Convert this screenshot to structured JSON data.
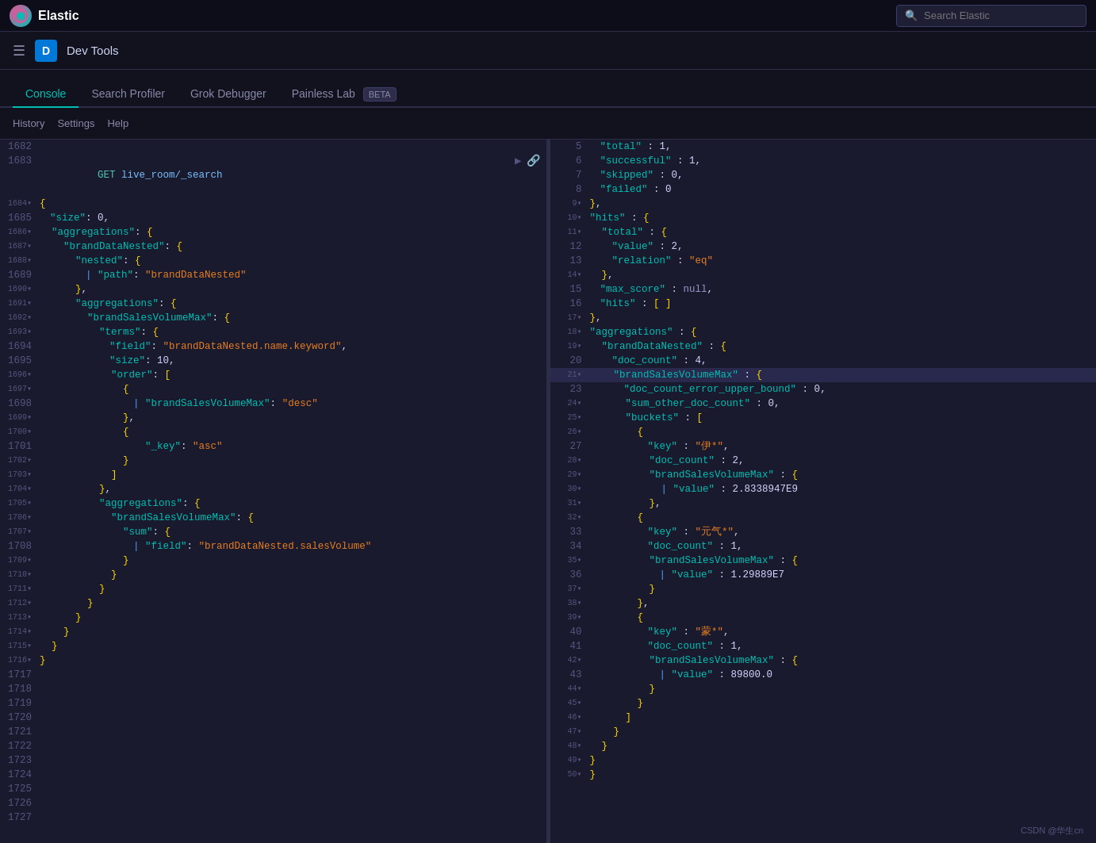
{
  "navbar": {
    "logo_text": "Elastic",
    "search_placeholder": "Search Elastic"
  },
  "breadcrumb": {
    "badge_letter": "D",
    "title": "Dev Tools"
  },
  "tabs": [
    {
      "label": "Console",
      "active": true
    },
    {
      "label": "Search Profiler",
      "active": false
    },
    {
      "label": "Grok Debugger",
      "active": false
    },
    {
      "label": "Painless Lab",
      "active": false,
      "beta": true
    }
  ],
  "toolbar": {
    "history": "History",
    "settings": "Settings",
    "help": "Help"
  },
  "editor": {
    "lines": [
      {
        "num": "1682",
        "fold": false,
        "content": ""
      },
      {
        "num": "1683",
        "fold": false,
        "content": "GET live_room/_search",
        "is_request": true
      },
      {
        "num": "1684",
        "fold": true,
        "content": "{"
      },
      {
        "num": "1685",
        "fold": false,
        "content": "  \"size\": 0,"
      },
      {
        "num": "1686",
        "fold": true,
        "content": "  \"aggregations\": {"
      },
      {
        "num": "1687",
        "fold": true,
        "content": "    \"brandDataNested\": {"
      },
      {
        "num": "1688",
        "fold": true,
        "content": "      \"nested\": {"
      },
      {
        "num": "1689",
        "fold": false,
        "content": "        | \"path\": \"brandDataNested\""
      },
      {
        "num": "1690",
        "fold": true,
        "content": "      },"
      },
      {
        "num": "1691",
        "fold": true,
        "content": "      \"aggregations\": {"
      },
      {
        "num": "1692",
        "fold": true,
        "content": "        \"brandSalesVolumeMax\": {"
      },
      {
        "num": "1693",
        "fold": true,
        "content": "          \"terms\": {"
      },
      {
        "num": "1694",
        "fold": false,
        "content": "            \"field\": \"brandDataNested.name.keyword\","
      },
      {
        "num": "1695",
        "fold": false,
        "content": "            \"size\": 10,"
      },
      {
        "num": "1696",
        "fold": true,
        "content": "            \"order\": ["
      },
      {
        "num": "1697",
        "fold": true,
        "content": "              {"
      },
      {
        "num": "1698",
        "fold": false,
        "content": "                | \"brandSalesVolumeMax\": \"desc\""
      },
      {
        "num": "1699",
        "fold": true,
        "content": "              },"
      },
      {
        "num": "1700",
        "fold": true,
        "content": "              {"
      },
      {
        "num": "1701",
        "fold": false,
        "content": "                  \"_key\": \"asc\""
      },
      {
        "num": "1702",
        "fold": true,
        "content": "              }"
      },
      {
        "num": "1703",
        "fold": true,
        "content": "            ]"
      },
      {
        "num": "1704",
        "fold": true,
        "content": "          },"
      },
      {
        "num": "1705",
        "fold": true,
        "content": "          \"aggregations\": {"
      },
      {
        "num": "1706",
        "fold": true,
        "content": "            \"brandSalesVolumeMax\": {"
      },
      {
        "num": "1707",
        "fold": true,
        "content": "              \"sum\": {"
      },
      {
        "num": "1708",
        "fold": false,
        "content": "                | \"field\": \"brandDataNested.salesVolume\""
      },
      {
        "num": "1709",
        "fold": true,
        "content": "              }"
      },
      {
        "num": "1710",
        "fold": true,
        "content": "            }"
      },
      {
        "num": "1711",
        "fold": true,
        "content": "          }"
      },
      {
        "num": "1712",
        "fold": true,
        "content": "        }"
      },
      {
        "num": "1713",
        "fold": true,
        "content": "      }"
      },
      {
        "num": "1714",
        "fold": true,
        "content": "    }"
      },
      {
        "num": "1715",
        "fold": true,
        "content": "  }"
      },
      {
        "num": "1716",
        "fold": true,
        "content": "}"
      },
      {
        "num": "1717",
        "fold": false,
        "content": ""
      },
      {
        "num": "1718",
        "fold": false,
        "content": ""
      },
      {
        "num": "1719",
        "fold": false,
        "content": ""
      },
      {
        "num": "1720",
        "fold": false,
        "content": ""
      },
      {
        "num": "1721",
        "fold": false,
        "content": ""
      },
      {
        "num": "1722",
        "fold": false,
        "content": ""
      },
      {
        "num": "1723",
        "fold": false,
        "content": ""
      },
      {
        "num": "1724",
        "fold": false,
        "content": ""
      },
      {
        "num": "1725",
        "fold": false,
        "content": ""
      },
      {
        "num": "1726",
        "fold": false,
        "content": ""
      },
      {
        "num": "1727",
        "fold": false,
        "content": ""
      }
    ]
  },
  "response": {
    "lines": [
      {
        "num": "5",
        "fold": false,
        "content": "  \"total\" : 1,"
      },
      {
        "num": "6",
        "fold": false,
        "content": "  \"successful\" : 1,"
      },
      {
        "num": "7",
        "fold": false,
        "content": "  \"skipped\" : 0,"
      },
      {
        "num": "8",
        "fold": false,
        "content": "  \"failed\" : 0"
      },
      {
        "num": "9",
        "fold": true,
        "content": "},"
      },
      {
        "num": "10",
        "fold": true,
        "content": "\"hits\" : {"
      },
      {
        "num": "11",
        "fold": true,
        "content": "  \"total\" : {"
      },
      {
        "num": "12",
        "fold": false,
        "content": "    \"value\" : 2,"
      },
      {
        "num": "13",
        "fold": false,
        "content": "    \"relation\" : \"eq\""
      },
      {
        "num": "14",
        "fold": true,
        "content": "  },"
      },
      {
        "num": "15",
        "fold": false,
        "content": "  \"max_score\" : null,"
      },
      {
        "num": "16",
        "fold": false,
        "content": "  \"hits\" : [ ]"
      },
      {
        "num": "17",
        "fold": true,
        "content": "},"
      },
      {
        "num": "18",
        "fold": true,
        "content": "\"aggregations\" : {"
      },
      {
        "num": "19",
        "fold": true,
        "content": "  \"brandDataNested\" : {"
      },
      {
        "num": "20",
        "fold": false,
        "content": "    \"doc_count\" : 4,"
      },
      {
        "num": "21",
        "fold": true,
        "content": "    \"brandSalesVolumeMax\" : {",
        "highlighted": true
      },
      {
        "num": "23",
        "fold": false,
        "content": "      \"doc_count_error_upper_bound\" : 0,"
      },
      {
        "num": "24",
        "fold": false,
        "content": "      \"sum_other_doc_count\" : 0,"
      },
      {
        "num": "25",
        "fold": true,
        "content": "      \"buckets\" : ["
      },
      {
        "num": "26",
        "fold": true,
        "content": "        {"
      },
      {
        "num": "27",
        "fold": false,
        "content": "          \"key\" : \"伊*\","
      },
      {
        "num": "28",
        "fold": true,
        "content": "          \"doc_count\" : 2,"
      },
      {
        "num": "29",
        "fold": true,
        "content": "          \"brandSalesVolumeMax\" : {"
      },
      {
        "num": "30",
        "fold": true,
        "content": "            | \"value\" : 2.8338947E9"
      },
      {
        "num": "31",
        "fold": true,
        "content": "          },"
      },
      {
        "num": "32",
        "fold": true,
        "content": "        {"
      },
      {
        "num": "33",
        "fold": false,
        "content": "          \"key\" : \"元气*\","
      },
      {
        "num": "34",
        "fold": false,
        "content": "          \"doc_count\" : 1,"
      },
      {
        "num": "35",
        "fold": true,
        "content": "          \"brandSalesVolumeMax\" : {"
      },
      {
        "num": "36",
        "fold": false,
        "content": "            | \"value\" : 1.29889E7"
      },
      {
        "num": "37",
        "fold": true,
        "content": "          }"
      },
      {
        "num": "38",
        "fold": true,
        "content": "        },"
      },
      {
        "num": "39",
        "fold": true,
        "content": "        {"
      },
      {
        "num": "40",
        "fold": false,
        "content": "          \"key\" : \"蒙*\","
      },
      {
        "num": "41",
        "fold": false,
        "content": "          \"doc_count\" : 1,"
      },
      {
        "num": "42",
        "fold": true,
        "content": "          \"brandSalesVolumeMax\" : {"
      },
      {
        "num": "43",
        "fold": false,
        "content": "            | \"value\" : 89800.0"
      },
      {
        "num": "44",
        "fold": true,
        "content": "          }"
      },
      {
        "num": "45",
        "fold": true,
        "content": "        }"
      },
      {
        "num": "46",
        "fold": true,
        "content": "      ]"
      },
      {
        "num": "47",
        "fold": true,
        "content": "    }"
      },
      {
        "num": "48",
        "fold": true,
        "content": "  }"
      },
      {
        "num": "49",
        "fold": true,
        "content": "}"
      },
      {
        "num": "50",
        "fold": true,
        "content": "}"
      }
    ]
  },
  "watermark": "CSDN @华生cn"
}
